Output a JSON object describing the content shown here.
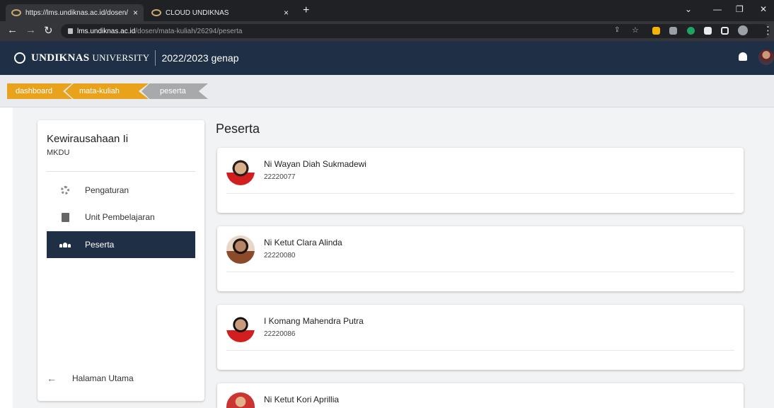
{
  "browser": {
    "tabs": [
      {
        "title": "https://lms.undiknas.ac.id/dosen/",
        "active": true
      },
      {
        "title": "CLOUD UNDIKNAS",
        "active": false
      }
    ],
    "url_host": "lms.undiknas.ac.id",
    "url_path": "/dosen/mata-kuliah/26294/peserta",
    "close_symbol": "×",
    "new_tab_symbol": "+"
  },
  "header": {
    "brand_main": "UNDIKNAS",
    "brand_sub": "UNIVERSITY",
    "term": "2022/2023 genap"
  },
  "breadcrumb": [
    "dashboard",
    "mata-kuliah",
    "peserta"
  ],
  "sidebar": {
    "course_title": "Kewirausahaan Ii",
    "course_code": "MKDU",
    "items": [
      {
        "label": "Pengaturan",
        "icon": "gear-icon",
        "active": false
      },
      {
        "label": "Unit Pembelajaran",
        "icon": "book-icon",
        "active": false
      },
      {
        "label": "Peserta",
        "icon": "people-icon",
        "active": true
      }
    ],
    "home_label": "Halaman Utama"
  },
  "main": {
    "title": "Peserta",
    "participants": [
      {
        "name": "Ni Wayan Diah Sukmadewi",
        "nim": "22220077"
      },
      {
        "name": "Ni Ketut Clara Alinda",
        "nim": "22220080"
      },
      {
        "name": "I Komang Mahendra Putra",
        "nim": "22220086"
      },
      {
        "name": "Ni Ketut Kori Aprillia",
        "nim": ""
      }
    ]
  },
  "colors": {
    "header_bg": "#1f2f45",
    "crumb_active": "#e8a21c",
    "crumb_current": "#a7a9ab"
  }
}
